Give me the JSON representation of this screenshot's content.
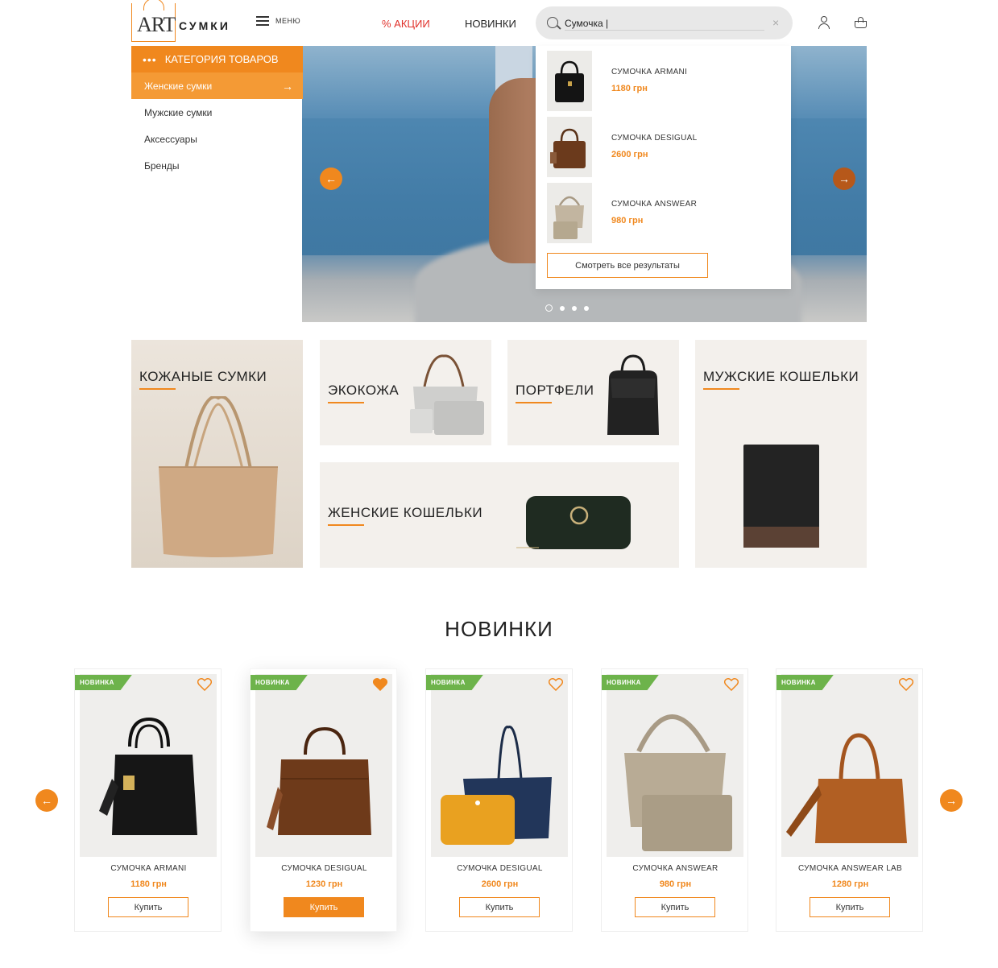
{
  "header": {
    "logo_art": "ART",
    "logo_text": "СУМКИ",
    "menu_label": "МЕНЮ",
    "nav_sale": "% АКЦИИ",
    "nav_new": "НОВИНКИ",
    "search_value": "Сумочка |",
    "clear_symbol": "×"
  },
  "sidebar": {
    "header_dots": "•••",
    "header_label": "КАТЕГОРИЯ ТОВАРОВ",
    "items": [
      {
        "label": "Женские сумки",
        "arrow": "→"
      },
      {
        "label": "Мужские сумки"
      },
      {
        "label": "Аксессуары"
      },
      {
        "label": "Бренды"
      }
    ]
  },
  "hero": {
    "arrow_left": "←",
    "arrow_right": "→",
    "dots_count": 4,
    "active_dot": 0
  },
  "search_results": {
    "items": [
      {
        "name": "СУМОЧКА ARMANI",
        "price": "1180 грн"
      },
      {
        "name": "СУМОЧКА DESIGUAL",
        "price": "2600 грн"
      },
      {
        "name": "СУМОЧКА ANSWEAR",
        "price": "980 грн"
      }
    ],
    "view_all": "Смотреть все результаты"
  },
  "categories": {
    "leather": "КОЖАНЫЕ СУМКИ",
    "eco": "ЭКОКОЖА",
    "portfolio": "ПОРТФЕЛИ",
    "men_wallets": "МУЖСКИЕ КОШЕЛЬКИ",
    "women_wallets": "ЖЕНСКИЕ КОШЕЛЬКИ"
  },
  "novinki": {
    "title": "НОВИНКИ",
    "arrow_left": "←",
    "arrow_right": "→",
    "badge": "НОВИНКА",
    "products": [
      {
        "name": "СУМОЧКА ARMANI",
        "price": "1180 грн",
        "button": "Купить",
        "favorite": false
      },
      {
        "name": "СУМОЧКА DESIGUAL",
        "price": "1230 грн",
        "button": "Купить",
        "favorite": true
      },
      {
        "name": "СУМОЧКА DESIGUAL",
        "price": "2600 грн",
        "button": "Купить",
        "favorite": false
      },
      {
        "name": "СУМОЧКА ANSWEAR",
        "price": "980 грн",
        "button": "Купить",
        "favorite": false
      },
      {
        "name": "СУМОЧКА ANSWEAR LAB",
        "price": "1280 грн",
        "button": "Купить",
        "favorite": false
      }
    ]
  },
  "colors": {
    "accent": "#f0881e",
    "sale": "#e0312b",
    "badge": "#6db34b"
  }
}
